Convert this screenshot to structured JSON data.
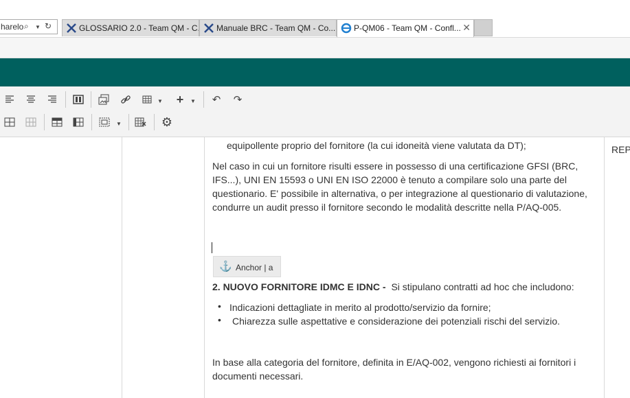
{
  "browser": {
    "address_text": "harelo",
    "tabs": [
      {
        "label": "GLOSSARIO 2.0 - Team QM - C..."
      },
      {
        "label": "Manuale BRC - Team QM - Co..."
      },
      {
        "label": "P-QM06 - Team QM - Confl..."
      }
    ]
  },
  "right_col": {
    "label": "REP"
  },
  "document": {
    "line_top": "equipollente proprio del fornitore (la cui idoneità viene valutata da DT);",
    "para1": [
      "Nel caso in cui un fornitore risulti essere in possesso di una certificazione GFSI (BRC,",
      "IFS...), UNI EN 15593 o UNI EN ISO 22000 è tenuto a compilare solo una parte del",
      "questionario. E' possibile in alternativa, o per integrazione al questionario di valutazione,",
      "condurre un audit presso il fornitore secondo le modalità descritte nella P/AQ-005."
    ],
    "anchor_label": "Anchor | a",
    "heading_bold": "2. NUOVO FORNITORE IDMC E IDNC -",
    "heading_rest": "Si stipulano  contratti ad hoc che includono:",
    "bullets": [
      "Indicazioni dettagliate in merito al prodotto/servizio da fornire;",
      "Chiarezza sulle aspettative e considerazione dei potenziali rischi del servizio."
    ],
    "para2": [
      "In base alla categoria del fornitore, definita in E/AQ-002, vengono richiesti ai fornitori i",
      "documenti necessari."
    ]
  }
}
